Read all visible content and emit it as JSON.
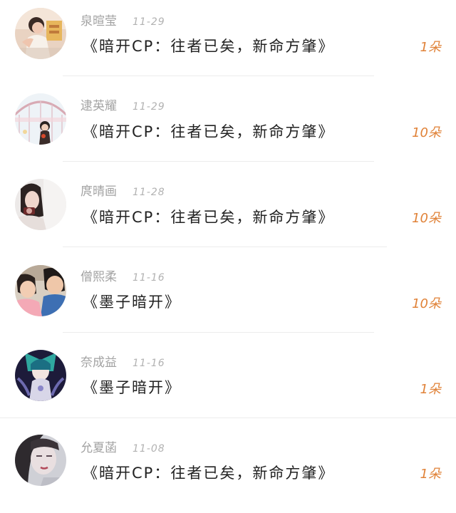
{
  "gift_records": [
    {
      "name": "泉暄莹",
      "date": "11-29",
      "title": "《暗开CP：往者已矣，新命方肇》",
      "gift": "1朵"
    },
    {
      "name": "逮英耀",
      "date": "11-29",
      "title": "《暗开CP：往者已矣，新命方肇》",
      "gift": "10朵"
    },
    {
      "name": "庹晴画",
      "date": "11-28",
      "title": "《暗开CP：往者已矣，新命方肇》",
      "gift": "10朵"
    },
    {
      "name": "僧熙柔",
      "date": "11-16",
      "title": "《墨子暗开》",
      "gift": "10朵"
    },
    {
      "name": "奈成益",
      "date": "11-16",
      "title": "《墨子暗开》",
      "gift": "1朵"
    },
    {
      "name": "允夏菡",
      "date": "11-08",
      "title": "《暗开CP：往者已矣，新命方肇》",
      "gift": "1朵"
    }
  ],
  "colors": {
    "name_text": "#a3a3a3",
    "title_text": "#222222",
    "gift_text": "#e08238",
    "divider": "#ececec"
  }
}
